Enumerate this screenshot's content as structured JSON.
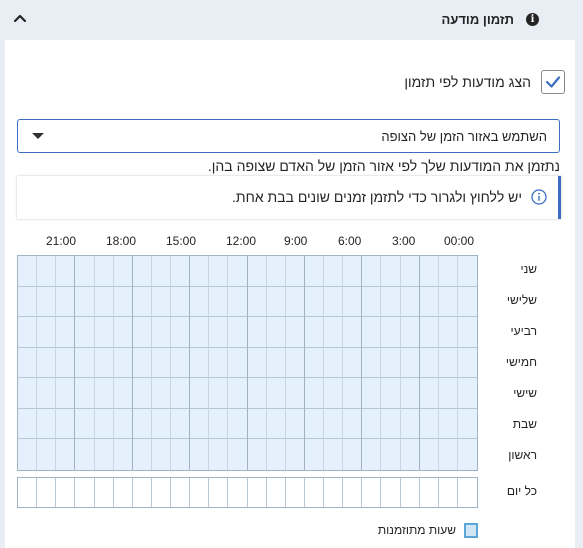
{
  "header": {
    "title": "תזמון מודעה",
    "info_icon": "info-icon",
    "collapse_icon": "chevron-up-icon"
  },
  "schedule_toggle": {
    "label": "הצג מודעות לפי תזמון",
    "checked": true
  },
  "timezone_select": {
    "value": "השתמש באזור הזמן של הצופה"
  },
  "help_text": "נתזמן את המודעות שלך לפי אזור הזמן של האדם שצופה בהן.",
  "info_bar": {
    "icon": "info-circle-icon",
    "text": "יש ללחוץ ולגרור כדי לתזמן זמנים שונים בבת אחת."
  },
  "hours": [
    "00:00",
    "3:00",
    "6:00",
    "9:00",
    "12:00",
    "15:00",
    "18:00",
    "21:00"
  ],
  "days": [
    "שני",
    "שלישי",
    "רביעי",
    "חמישי",
    "שישי",
    "שבת",
    "ראשון"
  ],
  "all_days_label": "כל יום",
  "legend": {
    "label": "שעות מתוזמנות",
    "color": "#cfe6f7"
  },
  "colors": {
    "accent": "#3b6ec2",
    "scheduled_fill": "#e4f0fb",
    "page_bg": "#e9eef4"
  }
}
